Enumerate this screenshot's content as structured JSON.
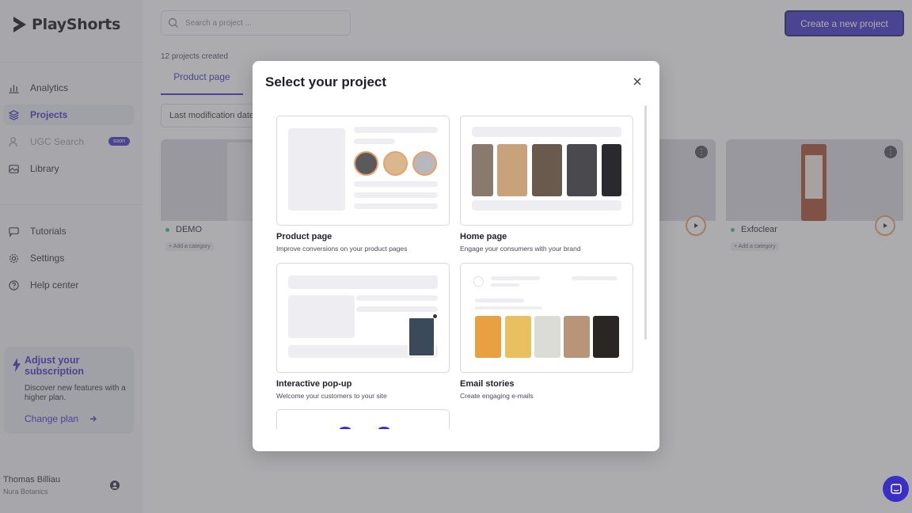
{
  "app": {
    "name": "PlayShorts"
  },
  "sidebar": {
    "items": [
      {
        "label": "Analytics",
        "icon": "bar-chart-icon"
      },
      {
        "label": "Projects",
        "icon": "layers-icon"
      },
      {
        "label": "UGC Search",
        "icon": "person-search-icon",
        "badge": "soon"
      },
      {
        "label": "Library",
        "icon": "image-icon"
      },
      {
        "label": "Tutorials",
        "icon": "chat-icon"
      },
      {
        "label": "Settings",
        "icon": "gear-icon"
      },
      {
        "label": "Help center",
        "icon": "help-icon"
      }
    ],
    "promo": {
      "title": "Adjust your subscription",
      "text": "Discover new features with a higher plan.",
      "link": "Change plan"
    },
    "user": {
      "name": "Thomas Billiau",
      "company": "Nura Botanics"
    }
  },
  "header": {
    "search_placeholder": "Search a project ...",
    "create_button": "Create a new project"
  },
  "main": {
    "count": "12 projects created",
    "tab": "Product page",
    "sort": "Last modification date",
    "cards": [
      {
        "title": "DEMO",
        "category": "+ Add a category"
      },
      {
        "title": "Exfoclear",
        "category": "+ Add a category"
      }
    ]
  },
  "modal": {
    "title": "Select your project",
    "options": [
      {
        "title": "Product page",
        "desc": "Improve conversions on your product pages"
      },
      {
        "title": "Home page",
        "desc": "Engage your consumers with your brand"
      },
      {
        "title": "Interactive pop-up",
        "desc": "Welcome your customers to your site"
      },
      {
        "title": "Email stories",
        "desc": "Create engaging e-mails"
      }
    ]
  },
  "colors": {
    "accent": "#3a2ec5",
    "active_dot": "#3cbf6a"
  }
}
